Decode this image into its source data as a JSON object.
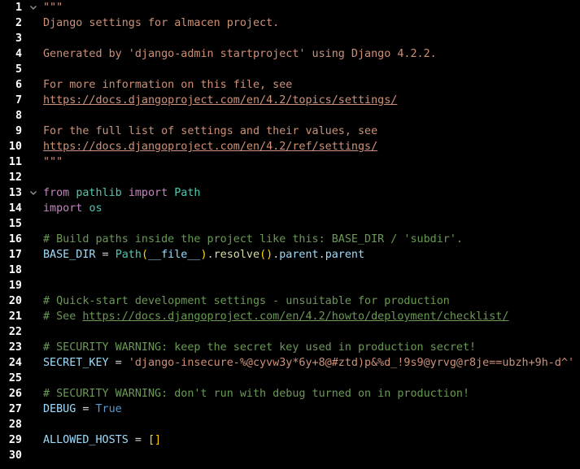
{
  "editor": {
    "language": "python",
    "colors": {
      "background": "#000000",
      "line_number": "#ffffff",
      "string": "#ce9178",
      "keyword": "#c586c0",
      "type": "#4ec9b0",
      "variable": "#9cdcfe",
      "operator": "#d4d4d4",
      "function": "#dcdcaa",
      "comment": "#6a9955",
      "constant": "#569cd6",
      "bracket_level1": "#ffd700",
      "bracket_level2": "#da70d6"
    },
    "fold_icon": "chevron-down-icon",
    "lines": [
      {
        "num": "1",
        "fold": true,
        "tokens": [
          [
            "string",
            "\"\"\""
          ]
        ]
      },
      {
        "num": "2",
        "tokens": [
          [
            "string",
            "Django settings for almacen project."
          ]
        ]
      },
      {
        "num": "3",
        "tokens": []
      },
      {
        "num": "4",
        "tokens": [
          [
            "string",
            "Generated by 'django-admin startproject' using Django 4.2.2."
          ]
        ]
      },
      {
        "num": "5",
        "tokens": []
      },
      {
        "num": "6",
        "tokens": [
          [
            "string",
            "For more information on this file, see"
          ]
        ]
      },
      {
        "num": "7",
        "tokens": [
          [
            "link",
            "https://docs.djangoproject.com/en/4.2/topics/settings/"
          ]
        ]
      },
      {
        "num": "8",
        "tokens": []
      },
      {
        "num": "9",
        "tokens": [
          [
            "string",
            "For the full list of settings and their values, see"
          ]
        ]
      },
      {
        "num": "10",
        "tokens": [
          [
            "link",
            "https://docs.djangoproject.com/en/4.2/ref/settings/"
          ]
        ]
      },
      {
        "num": "11",
        "tokens": [
          [
            "string",
            "\"\"\""
          ]
        ]
      },
      {
        "num": "12",
        "tokens": []
      },
      {
        "num": "13",
        "fold": true,
        "tokens": [
          [
            "kw",
            "from"
          ],
          [
            "plain",
            " "
          ],
          [
            "type",
            "pathlib"
          ],
          [
            "plain",
            " "
          ],
          [
            "kw",
            "import"
          ],
          [
            "plain",
            " "
          ],
          [
            "type",
            "Path"
          ]
        ]
      },
      {
        "num": "14",
        "tokens": [
          [
            "kw",
            "import"
          ],
          [
            "plain",
            " "
          ],
          [
            "type",
            "os"
          ]
        ]
      },
      {
        "num": "15",
        "tokens": []
      },
      {
        "num": "16",
        "tokens": [
          [
            "comment",
            "# Build paths inside the project like this: BASE_DIR / 'subdir'."
          ]
        ]
      },
      {
        "num": "17",
        "tokens": [
          [
            "var",
            "BASE_DIR"
          ],
          [
            "op",
            " = "
          ],
          [
            "type",
            "Path"
          ],
          [
            "paren1",
            "("
          ],
          [
            "var",
            "__file__"
          ],
          [
            "paren1",
            ")"
          ],
          [
            "op",
            "."
          ],
          [
            "fn",
            "resolve"
          ],
          [
            "paren1",
            "()"
          ],
          [
            "op",
            "."
          ],
          [
            "var",
            "parent"
          ],
          [
            "op",
            "."
          ],
          [
            "var",
            "parent"
          ]
        ]
      },
      {
        "num": "18",
        "tokens": []
      },
      {
        "num": "19",
        "tokens": []
      },
      {
        "num": "20",
        "tokens": [
          [
            "comment",
            "# Quick-start development settings - unsuitable for production"
          ]
        ]
      },
      {
        "num": "21",
        "tokens": [
          [
            "comment",
            "# See "
          ],
          [
            "commentlink",
            "https://docs.djangoproject.com/en/4.2/howto/deployment/checklist/"
          ]
        ]
      },
      {
        "num": "22",
        "tokens": []
      },
      {
        "num": "23",
        "tokens": [
          [
            "comment",
            "# SECURITY WARNING: keep the secret key used in production secret!"
          ]
        ]
      },
      {
        "num": "24",
        "tokens": [
          [
            "var",
            "SECRET_KEY"
          ],
          [
            "op",
            " = "
          ],
          [
            "string",
            "'django-insecure-%@cyvw3y*6y+8@#ztd)p&%d_!9s9@yrvg@r8je==ubzh+9h-d^'"
          ]
        ]
      },
      {
        "num": "25",
        "tokens": []
      },
      {
        "num": "26",
        "tokens": [
          [
            "comment",
            "# SECURITY WARNING: don't run with debug turned on in production!"
          ]
        ]
      },
      {
        "num": "27",
        "tokens": [
          [
            "var",
            "DEBUG"
          ],
          [
            "op",
            " = "
          ],
          [
            "const",
            "True"
          ]
        ]
      },
      {
        "num": "28",
        "tokens": []
      },
      {
        "num": "29",
        "tokens": [
          [
            "var",
            "ALLOWED_HOSTS"
          ],
          [
            "op",
            " = "
          ],
          [
            "paren1",
            "[]"
          ]
        ]
      },
      {
        "num": "30",
        "tokens": []
      }
    ]
  }
}
